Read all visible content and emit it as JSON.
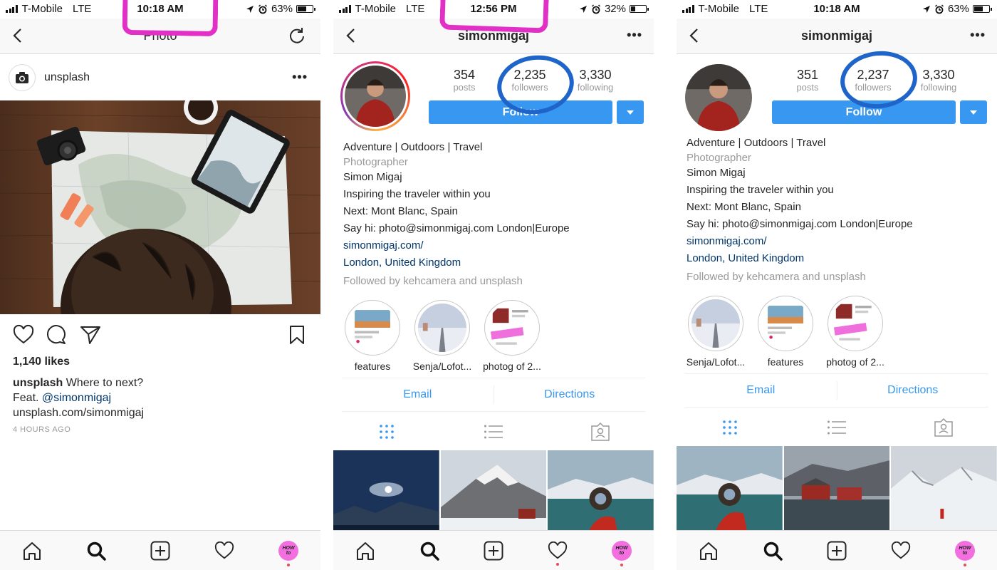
{
  "colors": {
    "accent": "#3897f0",
    "annotation_pink": "#e22fc6",
    "annotation_blue": "#1f64c8",
    "like_dot": "#ed4956"
  },
  "screens": [
    {
      "status": {
        "carrier": "T-Mobile",
        "network": "LTE",
        "time": "10:18 AM",
        "battery": "63%",
        "battery_level": 0.63
      },
      "nav": {
        "title": "Photo",
        "right_icon": "refresh-icon"
      },
      "post": {
        "username": "unsplash",
        "likes": "1,140 likes",
        "caption_user": "unsplash",
        "caption_text": "Where to next?",
        "caption_line2_prefix": "Feat. ",
        "caption_mention": "@simonmigaj",
        "caption_line3": "unsplash.com/simonmigaj",
        "time_ago": "4 HOURS AGO"
      }
    },
    {
      "status": {
        "carrier": "T-Mobile",
        "network": "LTE",
        "time": "12:56 PM",
        "battery": "32%",
        "battery_level": 0.32
      },
      "nav": {
        "title": "simonmigaj",
        "right_icon": "more-icon"
      },
      "profile": {
        "stats": [
          {
            "value": "354",
            "label": "posts"
          },
          {
            "value": "2,235",
            "label": "followers"
          },
          {
            "value": "3,330",
            "label": "following"
          }
        ],
        "follow_label": "Follow",
        "bio": {
          "name_line": "Adventure | Outdoors | Travel",
          "category": "Photographer",
          "name": "Simon Migaj",
          "line1": "Inspiring the traveler within you",
          "line2": "Next: Mont Blanc, Spain",
          "line3": "Say hi: photo@simonmigaj.com London|Europe",
          "website": "simonmigaj.com/",
          "location": "London, United Kingdom",
          "followed_by": "Followed by kehcamera and unsplash"
        },
        "highlights": [
          "features",
          "Senja/Lofot...",
          "photog of 2..."
        ],
        "contact": {
          "email": "Email",
          "directions": "Directions"
        }
      }
    },
    {
      "status": {
        "carrier": "T-Mobile",
        "network": "LTE",
        "time": "10:18 AM",
        "battery": "63%",
        "battery_level": 0.63
      },
      "nav": {
        "title": "simonmigaj",
        "right_icon": "more-icon"
      },
      "profile": {
        "stats": [
          {
            "value": "351",
            "label": "posts"
          },
          {
            "value": "2,237",
            "label": "followers"
          },
          {
            "value": "3,330",
            "label": "following"
          }
        ],
        "follow_label": "Follow",
        "bio": {
          "name_line": "Adventure | Outdoors | Travel",
          "category": "Photographer",
          "name": "Simon Migaj",
          "line1": "Inspiring the traveler within you",
          "line2": "Next: Mont Blanc, Spain",
          "line3": "Say hi: photo@simonmigaj.com London|Europe",
          "website": "simonmigaj.com/",
          "location": "London, United Kingdom",
          "followed_by": "Followed by kehcamera and unsplash"
        },
        "highlights": [
          "Senja/Lofot...",
          "features",
          "photog of 2..."
        ],
        "contact": {
          "email": "Email",
          "directions": "Directions"
        }
      }
    }
  ],
  "tabbar": {
    "logo_text": "HOW TO PHOTOGRAPHY"
  }
}
